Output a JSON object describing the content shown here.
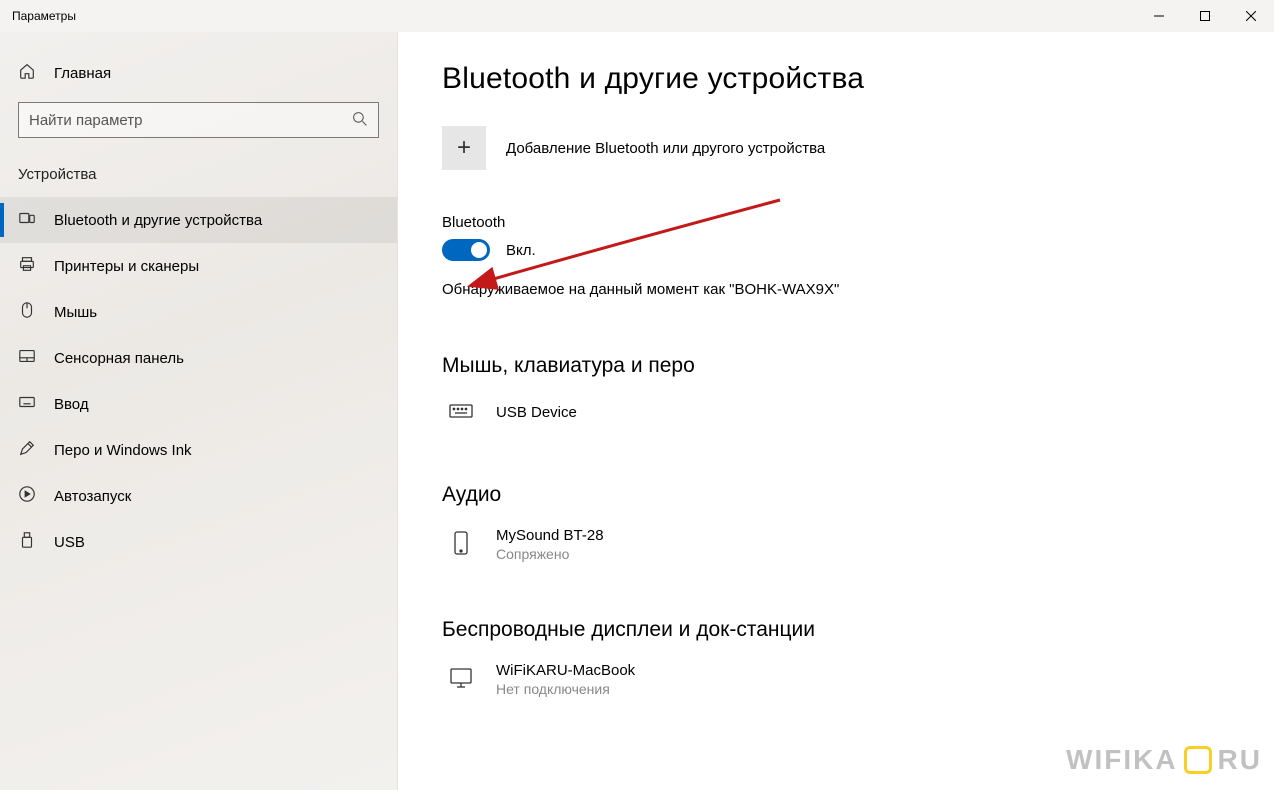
{
  "titlebar": {
    "title": "Параметры"
  },
  "sidebar": {
    "home_label": "Главная",
    "search_placeholder": "Найти параметр",
    "section_label": "Устройства",
    "items": [
      {
        "label": "Bluetooth и другие устройства",
        "icon": "devices",
        "active": true
      },
      {
        "label": "Принтеры и сканеры",
        "icon": "printer",
        "active": false
      },
      {
        "label": "Мышь",
        "icon": "mouse",
        "active": false
      },
      {
        "label": "Сенсорная панель",
        "icon": "touchpad",
        "active": false
      },
      {
        "label": "Ввод",
        "icon": "keyboard",
        "active": false
      },
      {
        "label": "Перо и Windows Ink",
        "icon": "pen",
        "active": false
      },
      {
        "label": "Автозапуск",
        "icon": "autoplay",
        "active": false
      },
      {
        "label": "USB",
        "icon": "usb",
        "active": false
      }
    ]
  },
  "main": {
    "page_title": "Bluetooth и другие устройства",
    "add_device_label": "Добавление Bluetooth или другого устройства",
    "bluetooth_heading": "Bluetooth",
    "bluetooth_toggle": {
      "on": true,
      "label": "Вкл."
    },
    "discoverable_text": "Обнаруживаемое на данный момент как \"BOHK-WAX9X\"",
    "groups": [
      {
        "heading": "Мышь, клавиатура и перо",
        "devices": [
          {
            "name": "USB Device",
            "status": "",
            "icon": "keyboard"
          }
        ]
      },
      {
        "heading": "Аудио",
        "devices": [
          {
            "name": "MySound BT-28",
            "status": "Сопряжено",
            "icon": "phone"
          }
        ]
      },
      {
        "heading": "Беспроводные дисплеи и док-станции",
        "devices": [
          {
            "name": "WiFiKARU-MacBook",
            "status": "Нет подключения",
            "icon": "monitor"
          }
        ]
      }
    ]
  },
  "watermark": {
    "text_left": "WIFIKA",
    "text_right": "RU"
  },
  "colors": {
    "accent": "#0067c0",
    "arrow": "#c41919"
  }
}
